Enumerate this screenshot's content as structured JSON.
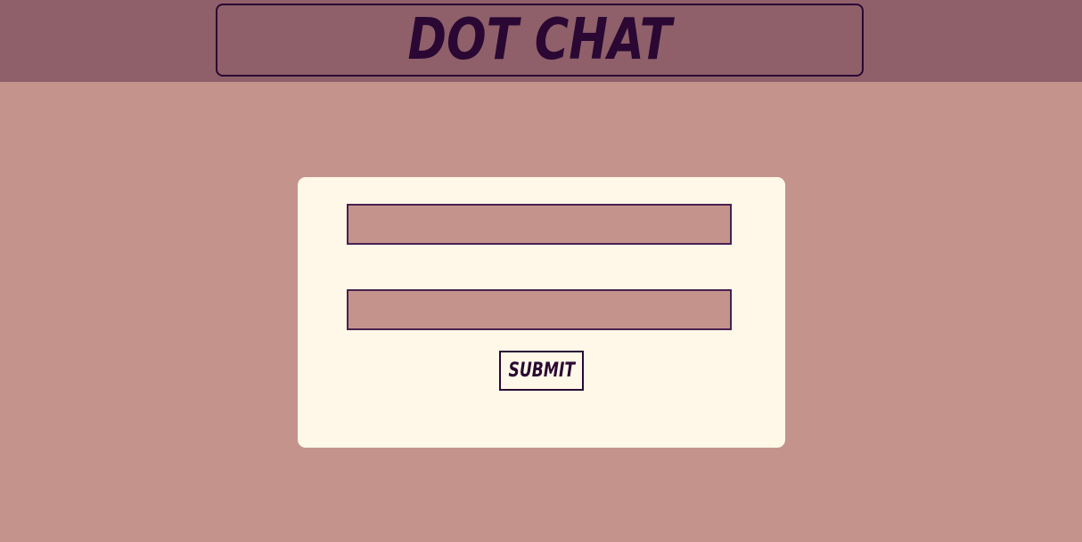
{
  "header": {
    "title": "DOT CHAT"
  },
  "form": {
    "username_value": "",
    "password_value": "",
    "submit_label": "SUBMIT"
  },
  "colors": {
    "page_background": "#c4948c",
    "header_background": "#8f606a",
    "card_background": "#fff8e8",
    "accent": "#2a0833"
  }
}
